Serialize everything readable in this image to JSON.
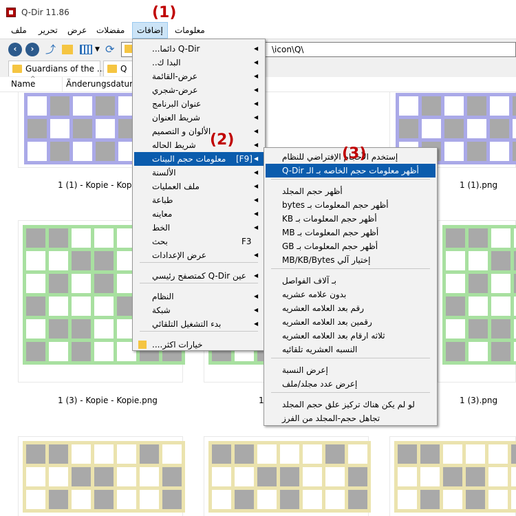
{
  "window": {
    "title": "Q-Dir 11.86"
  },
  "menubar": {
    "items": [
      {
        "id": "file",
        "label": "ملف"
      },
      {
        "id": "edit",
        "label": "تحرير"
      },
      {
        "id": "view",
        "label": "عرض"
      },
      {
        "id": "favorites",
        "label": "مفضلات"
      },
      {
        "id": "extras",
        "label": "إضافات"
      },
      {
        "id": "info",
        "label": "معلومات"
      }
    ]
  },
  "toolbar": {
    "address": "\\icon\\Q\\"
  },
  "tabs": [
    {
      "label": "Guardians of the ..."
    },
    {
      "label": "Q"
    }
  ],
  "columns": {
    "name": "Name",
    "date": "Änderungsdatum"
  },
  "files": [
    {
      "caption": "1 (1) - Kopie - Kopie.",
      "color": "#aaa9e8"
    },
    {
      "caption": "1 (1).png",
      "color": "#aaa9e8"
    },
    {
      "caption": "1 (3) - Kopie - Kopie.png",
      "color": "#a8e0a0"
    },
    {
      "caption": "1",
      "color": "#a8e0a0"
    },
    {
      "caption": "1 (3).png",
      "color": "#a8e0a0"
    }
  ],
  "grid_colors": {
    "blue": "#aaa9e8",
    "green": "#a8e0a0",
    "yellow": "#ebe3ae",
    "gray": "#a9a9a9"
  },
  "extras_menu": {
    "items": [
      {
        "label": "Q-Dir دائما...",
        "arrow": true
      },
      {
        "label": "البدا ك..",
        "arrow": true
      },
      {
        "label": "عرض-القائمة",
        "arrow": true
      },
      {
        "label": "عرض-شجري",
        "arrow": true
      },
      {
        "label": "عنوان البرنامج",
        "arrow": true
      },
      {
        "label": "شريط العنوان",
        "arrow": true
      },
      {
        "label": "الألوان و التصميم",
        "arrow": true
      },
      {
        "label": "شريط الحاله",
        "arrow": true
      },
      {
        "label": "معلومات حجم البينات",
        "arrow": true,
        "shortcut": "[F9]",
        "highlight": true
      },
      {
        "label": "الألسنة",
        "arrow": true
      },
      {
        "label": "ملف العمليات",
        "arrow": true
      },
      {
        "label": "طباعة",
        "arrow": true
      },
      {
        "label": "معاينه",
        "arrow": true
      },
      {
        "label": "الخط",
        "arrow": true
      },
      {
        "label": "بحث",
        "arrow": false,
        "shortcut": "F3"
      },
      {
        "label": "عرض الإعدادات",
        "arrow": true
      },
      {
        "label": "عين Q-Dir كمتصفح رئيسي",
        "arrow": true
      },
      {
        "label": "النظام",
        "arrow": true
      },
      {
        "label": "شبكة",
        "arrow": true
      },
      {
        "label": "بدء التشغيل التلقائي",
        "arrow": true
      },
      {
        "label": "خيارات اكثر....",
        "arrow": false,
        "folder": true
      }
    ]
  },
  "size_submenu": {
    "items": [
      {
        "label": "إستخدم الأحجام الإفتراضي للنظام"
      },
      {
        "label": "أظهر معلومات حجم الخاصه بـ الـ Q-Dir",
        "highlight": true
      },
      {
        "label": "أظهر حجم المجلد"
      },
      {
        "label": "أظهر حجم المعلومات بـ bytes"
      },
      {
        "label": "أظهر حجم المعلومات بـ KB"
      },
      {
        "label": "أظهر حجم المعلومات بـ MB"
      },
      {
        "label": "أظهر حجم المعلومات بـ GB"
      },
      {
        "label": "إختيار آلي MB/KB/Bytes"
      },
      {
        "label": "بـ آلاف الفواصل"
      },
      {
        "label": "بدون علامه عشريه"
      },
      {
        "label": "رقم بعد العلامه العشريه"
      },
      {
        "label": "رقمين بعد العلامه العشريه"
      },
      {
        "label": "ثلاثه ارقام بعد العلامه العشريه"
      },
      {
        "label": "النسبه العشريه تلقائيه"
      },
      {
        "label": "إعرض النسبة"
      },
      {
        "label": "إعرض عدد مجلد/ملف"
      },
      {
        "label": "لو لم يكن هناك تركيز علق حجم المجلد"
      },
      {
        "label": "تجاهل حجم-المجلد من الفرز"
      }
    ]
  },
  "annotations": [
    "(1)",
    "(2)",
    "(3)"
  ]
}
